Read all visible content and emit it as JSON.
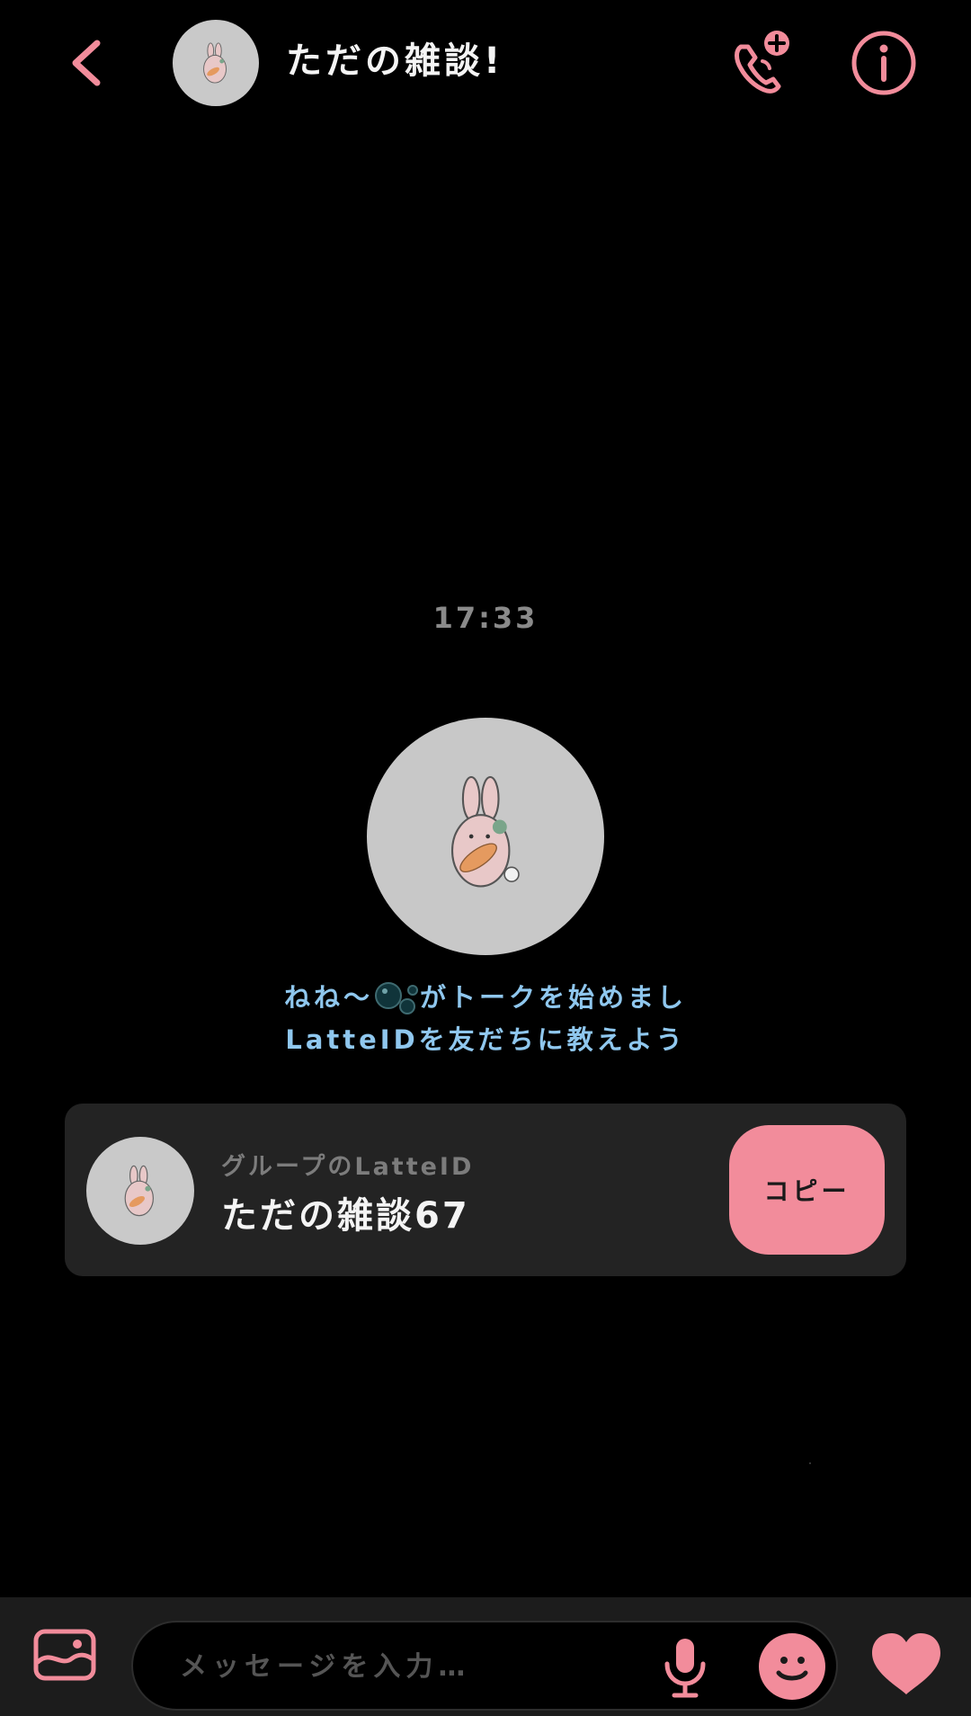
{
  "header": {
    "title": "ただの雑談!",
    "back_icon": "chevron-left-icon",
    "call_icon": "phone-plus-icon",
    "info_icon": "info-icon"
  },
  "chat": {
    "timestamp": "17:33",
    "system_message": {
      "line1_prefix": "ねね〜",
      "line1_suffix": "がトークを始めまし",
      "line2": "LatteIDを友だちに教えよう"
    }
  },
  "id_card": {
    "label": "グループのLatteID",
    "id_value": "ただの雑談67",
    "copy_label": "コピー"
  },
  "composer": {
    "placeholder": "メッセージを入力…",
    "image_icon": "image-icon",
    "mic_icon": "mic-icon",
    "emoji_icon": "smile-icon",
    "like_icon": "heart-icon"
  },
  "colors": {
    "accent": "#f28c9b",
    "background": "#000000",
    "card": "#232323",
    "system_text": "#8fc7ee",
    "avatar_bg": "#c8c8c8"
  }
}
